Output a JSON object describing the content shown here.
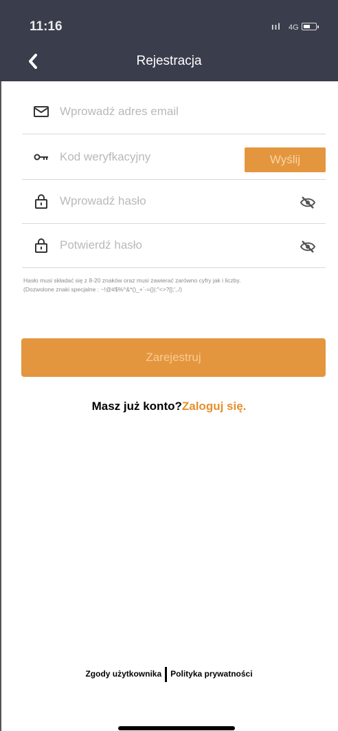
{
  "status_bar": {
    "time": "11:16",
    "network": "4G"
  },
  "nav": {
    "title": "Rejestracja"
  },
  "form": {
    "email_placeholder": "Wprowadź adres email",
    "code_placeholder": "Kod weryfkacyjny",
    "send_label": "Wyślij",
    "password_placeholder": "Wprowadź hasło",
    "confirm_placeholder": "Potwierdź hasło",
    "hint_line1": "Hasło musi składać się z 8-20 znaków oraz musi zawierać zarówno cyfry jak i liczby.",
    "hint_line2": "(Dozwolone znaki specjalne : ~!@#$%^&*()_+`-={}|:\"<>?[];',./)",
    "register_label": "Zarejestruj"
  },
  "account": {
    "question": "Masz już konto?",
    "login_link": "Zaloguj się."
  },
  "footer": {
    "consents": "Zgody użytkownika",
    "privacy": "Polityka prywatności"
  },
  "colors": {
    "header_bg": "#3a3d4c",
    "accent": "#e4963f"
  }
}
